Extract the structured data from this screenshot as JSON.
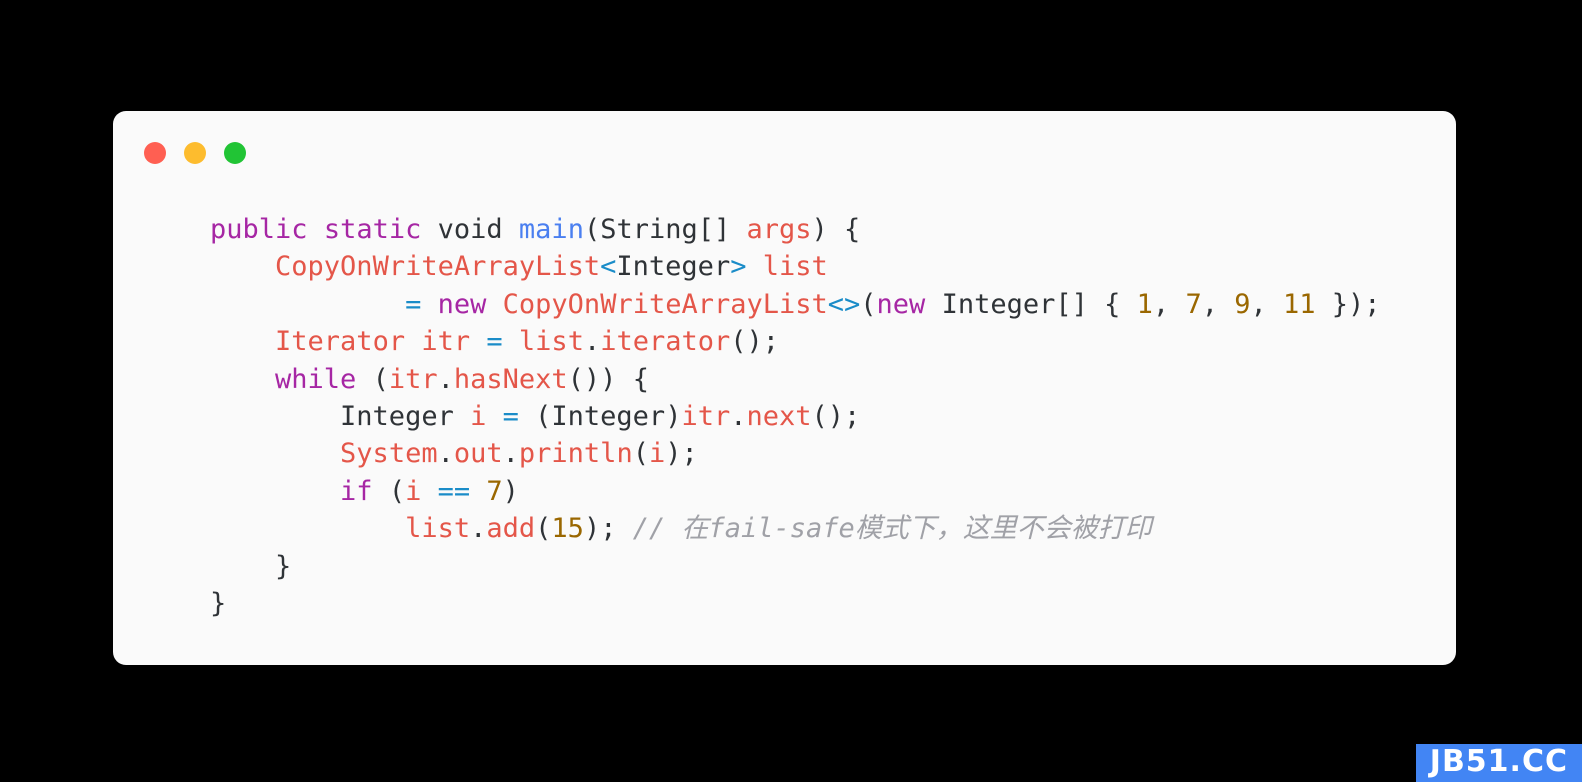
{
  "window": {
    "background_color": "#000000",
    "card_background": "#fafafa",
    "controls": [
      {
        "name": "close",
        "color": "#ff5f52"
      },
      {
        "name": "minimize",
        "color": "#fdbc2e"
      },
      {
        "name": "maximize",
        "color": "#21c435"
      }
    ]
  },
  "palette": {
    "keyword": "#a626a4",
    "plain": "#2f3337",
    "function": "#4a7ff0",
    "identifier": "#e45649",
    "operator": "#1a8cc8",
    "number": "#9a6700",
    "comment": "#a0a1a7",
    "watermark_bg": "#4285f4"
  },
  "code": {
    "language": "java",
    "lines": [
      {
        "indent": 0,
        "tokens": [
          {
            "t": "public",
            "c": "kw"
          },
          {
            "t": " ",
            "c": "plain"
          },
          {
            "t": "static",
            "c": "kw"
          },
          {
            "t": " ",
            "c": "plain"
          },
          {
            "t": "void",
            "c": "plain"
          },
          {
            "t": " ",
            "c": "plain"
          },
          {
            "t": "main",
            "c": "fn"
          },
          {
            "t": "(String[] ",
            "c": "plain"
          },
          {
            "t": "args",
            "c": "ident"
          },
          {
            "t": ") {",
            "c": "plain"
          }
        ]
      },
      {
        "indent": 0,
        "tokens": [
          {
            "t": "    ",
            "c": "plain"
          },
          {
            "t": "CopyOnWriteArrayList",
            "c": "ident"
          },
          {
            "t": "<",
            "c": "op"
          },
          {
            "t": "Integer",
            "c": "plain"
          },
          {
            "t": ">",
            "c": "op"
          },
          {
            "t": " ",
            "c": "plain"
          },
          {
            "t": "list",
            "c": "ident"
          }
        ]
      },
      {
        "indent": 0,
        "tokens": [
          {
            "t": "            ",
            "c": "plain"
          },
          {
            "t": "=",
            "c": "op"
          },
          {
            "t": " ",
            "c": "plain"
          },
          {
            "t": "new",
            "c": "kw"
          },
          {
            "t": " ",
            "c": "plain"
          },
          {
            "t": "CopyOnWriteArrayList",
            "c": "ident"
          },
          {
            "t": "<>",
            "c": "op"
          },
          {
            "t": "(",
            "c": "plain"
          },
          {
            "t": "new",
            "c": "kw"
          },
          {
            "t": " Integer[] { ",
            "c": "plain"
          },
          {
            "t": "1",
            "c": "num"
          },
          {
            "t": ", ",
            "c": "plain"
          },
          {
            "t": "7",
            "c": "num"
          },
          {
            "t": ", ",
            "c": "plain"
          },
          {
            "t": "9",
            "c": "num"
          },
          {
            "t": ", ",
            "c": "plain"
          },
          {
            "t": "11",
            "c": "num"
          },
          {
            "t": " });",
            "c": "plain"
          }
        ]
      },
      {
        "indent": 0,
        "tokens": [
          {
            "t": "    ",
            "c": "plain"
          },
          {
            "t": "Iterator",
            "c": "ident"
          },
          {
            "t": " ",
            "c": "plain"
          },
          {
            "t": "itr",
            "c": "ident"
          },
          {
            "t": " ",
            "c": "plain"
          },
          {
            "t": "=",
            "c": "op"
          },
          {
            "t": " ",
            "c": "plain"
          },
          {
            "t": "list",
            "c": "ident"
          },
          {
            "t": ".",
            "c": "plain"
          },
          {
            "t": "iterator",
            "c": "ident"
          },
          {
            "t": "();",
            "c": "plain"
          }
        ]
      },
      {
        "indent": 0,
        "tokens": [
          {
            "t": "    ",
            "c": "plain"
          },
          {
            "t": "while",
            "c": "kw"
          },
          {
            "t": " (",
            "c": "plain"
          },
          {
            "t": "itr",
            "c": "ident"
          },
          {
            "t": ".",
            "c": "plain"
          },
          {
            "t": "hasNext",
            "c": "ident"
          },
          {
            "t": "()) {",
            "c": "plain"
          }
        ]
      },
      {
        "indent": 0,
        "tokens": [
          {
            "t": "        Integer ",
            "c": "plain"
          },
          {
            "t": "i",
            "c": "ident"
          },
          {
            "t": " ",
            "c": "plain"
          },
          {
            "t": "=",
            "c": "op"
          },
          {
            "t": " (Integer)",
            "c": "plain"
          },
          {
            "t": "itr",
            "c": "ident"
          },
          {
            "t": ".",
            "c": "plain"
          },
          {
            "t": "next",
            "c": "ident"
          },
          {
            "t": "();",
            "c": "plain"
          }
        ]
      },
      {
        "indent": 0,
        "tokens": [
          {
            "t": "        ",
            "c": "plain"
          },
          {
            "t": "System",
            "c": "ident"
          },
          {
            "t": ".",
            "c": "plain"
          },
          {
            "t": "out",
            "c": "ident"
          },
          {
            "t": ".",
            "c": "plain"
          },
          {
            "t": "println",
            "c": "ident"
          },
          {
            "t": "(",
            "c": "plain"
          },
          {
            "t": "i",
            "c": "ident"
          },
          {
            "t": ");",
            "c": "plain"
          }
        ]
      },
      {
        "indent": 0,
        "tokens": [
          {
            "t": "        ",
            "c": "plain"
          },
          {
            "t": "if",
            "c": "kw"
          },
          {
            "t": " (",
            "c": "plain"
          },
          {
            "t": "i",
            "c": "ident"
          },
          {
            "t": " ",
            "c": "plain"
          },
          {
            "t": "==",
            "c": "op"
          },
          {
            "t": " ",
            "c": "plain"
          },
          {
            "t": "7",
            "c": "num"
          },
          {
            "t": ")",
            "c": "plain"
          }
        ]
      },
      {
        "indent": 0,
        "tokens": [
          {
            "t": "            ",
            "c": "plain"
          },
          {
            "t": "list",
            "c": "ident"
          },
          {
            "t": ".",
            "c": "plain"
          },
          {
            "t": "add",
            "c": "ident"
          },
          {
            "t": "(",
            "c": "plain"
          },
          {
            "t": "15",
            "c": "num"
          },
          {
            "t": "); ",
            "c": "plain"
          },
          {
            "t": "// 在fail-safe模式下，这里不会被打印",
            "c": "comment"
          }
        ]
      },
      {
        "indent": 0,
        "tokens": [
          {
            "t": "    }",
            "c": "plain"
          }
        ]
      },
      {
        "indent": 0,
        "tokens": [
          {
            "t": "}",
            "c": "plain"
          }
        ]
      }
    ]
  },
  "watermark": {
    "text": "JB51.CC"
  }
}
